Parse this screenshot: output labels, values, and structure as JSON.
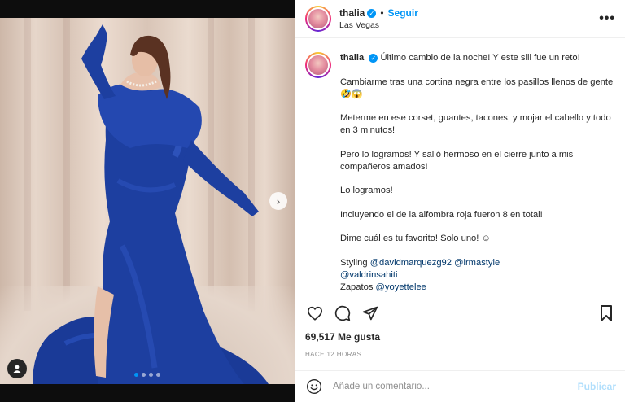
{
  "post": {
    "username": "thalia",
    "verified_icon": "verified-badge-icon",
    "separator": "•",
    "follow_label": "Seguir",
    "location": "Las Vegas",
    "more_icon": "•••",
    "next_arrow": "›",
    "carousel_dots": 4,
    "active_dot": 0
  },
  "caption": {
    "username": "thalia",
    "paragraphs": [
      "Último cambio de la noche! Y este siii fue un reto!",
      "Cambiarme tras una cortina negra entre los pasillos llenos de gente 🤣😱",
      "Meterme en ese corset, guantes, tacones, y mojar el cabello y todo en 3 minutos!",
      "Pero lo logramos! Y salió hermoso en el cierre junto a mis compañeros amados!",
      "Lo logramos!",
      "Incluyendo el de la alfombra roja fueron 8 en total!",
      "Dime cuál es tu favorito! Solo uno! ☺"
    ],
    "styling_label": "Styling",
    "mentions": [
      "@davidmarquezg92",
      "@irmastyle",
      "@valdrinsahiti"
    ],
    "zapatos_label": "Zapatos",
    "zapatos_mention": "@yoyettelee"
  },
  "actions": {
    "likes": "69,517",
    "likes_suffix": "Me gusta",
    "time": "HACE 12 HORAS"
  },
  "comment": {
    "placeholder": "Añade un comentario...",
    "publish_label": "Publicar"
  },
  "colors": {
    "accent": "#0095f6",
    "dress": "#1d3fa0",
    "publish_disabled": "#b2dffc"
  }
}
